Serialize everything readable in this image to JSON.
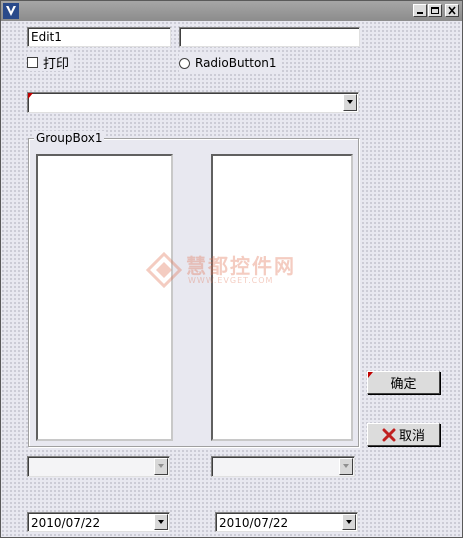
{
  "edit1": {
    "value": "Edit1"
  },
  "edit2": {
    "value": ""
  },
  "checkbox": {
    "label": "打印",
    "checked": false
  },
  "radio": {
    "label": "RadioButton1",
    "checked": false
  },
  "top_combo": {
    "value": ""
  },
  "groupbox": {
    "caption": "GroupBox1"
  },
  "ok_button": {
    "label": "确定"
  },
  "cancel_button": {
    "label": "取消"
  },
  "combo_left": {
    "value": ""
  },
  "combo_right": {
    "value": ""
  },
  "date_left": {
    "value": "2010/07/22"
  },
  "date_right": {
    "value": "2010/07/22"
  },
  "watermark": {
    "text": "慧都控件网",
    "url": "WWW.EVGET.COM"
  },
  "colors": {
    "accent_red": "#c00000",
    "cancel_x": "#c02020",
    "watermark": "#e07050"
  }
}
